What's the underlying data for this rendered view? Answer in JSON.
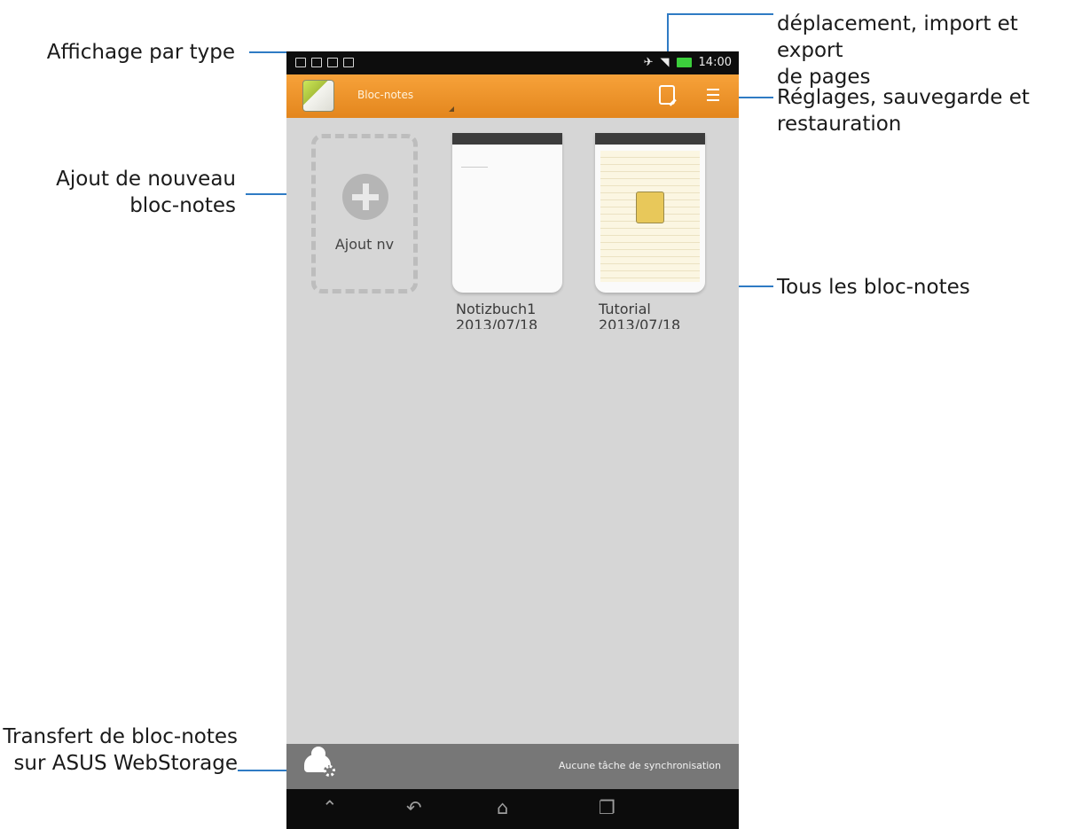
{
  "annotations": {
    "view_by_type": "Affichage par type",
    "top_right_partial": "déplacement, import et export",
    "top_right_line2": "de pages",
    "settings_line1": "Réglages, sauvegarde et",
    "settings_line2": "restauration",
    "add_new_line1": "Ajout de nouveau",
    "add_new_line2": "bloc-notes",
    "all_notebooks": "Tous les bloc-notes",
    "transfer_line1": "Transfert de bloc-notes",
    "transfer_line2": "sur ASUS WebStorage"
  },
  "status_bar": {
    "time": "14:00"
  },
  "app_bar": {
    "title": "Bloc-notes"
  },
  "new_tile": {
    "label": "Ajout nv"
  },
  "notebooks": [
    {
      "title": "Notizbuch1",
      "date": "2013/07/18"
    },
    {
      "title": "Tutorial",
      "date": "2013/07/18"
    }
  ],
  "bottom_bar": {
    "sync_status": "Aucune tâche de synchronisation"
  },
  "colors": {
    "accent": "#f09a2f",
    "callout": "#2f7bc4",
    "background": "#d6d6d6"
  }
}
